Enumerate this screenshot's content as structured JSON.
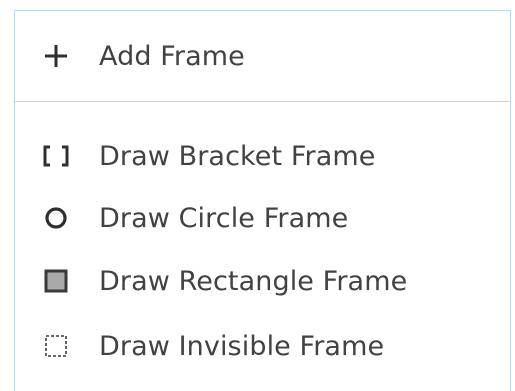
{
  "menu": {
    "add_frame": {
      "label": "Add Frame",
      "icon": "plus-icon"
    },
    "items": [
      {
        "label": "Draw Bracket Frame",
        "icon": "bracket-frame-icon"
      },
      {
        "label": "Draw Circle Frame",
        "icon": "circle-frame-icon"
      },
      {
        "label": "Draw Rectangle Frame",
        "icon": "rectangle-frame-icon"
      },
      {
        "label": "Draw Invisible Frame",
        "icon": "invisible-frame-icon"
      }
    ]
  },
  "colors": {
    "border": "#bcd9ea",
    "text": "#424242",
    "icon": "#2f2f2f",
    "rect_fill": "#a9a9a9"
  }
}
